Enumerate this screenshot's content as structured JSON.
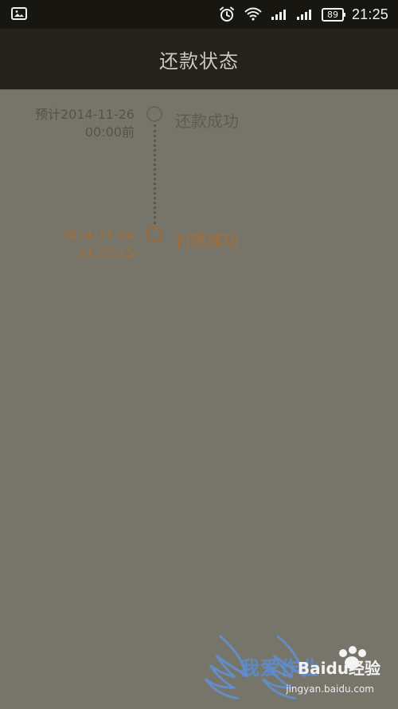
{
  "status_bar": {
    "icons": [
      "image-icon",
      "alarm-icon",
      "wifi-icon",
      "signal-icon",
      "signal-icon",
      "battery-icon"
    ],
    "battery_level": "89",
    "time": "21:25"
  },
  "header": {
    "title": "还款状态"
  },
  "timeline": {
    "steps": [
      {
        "label": "还款成功",
        "time_line1": "预计2014-11-26",
        "time_line2": "00:00前",
        "status": "pending"
      },
      {
        "label": "付款成功",
        "time_line1": "2014-11-24",
        "time_line2": "21:22:15",
        "status": "done"
      }
    ]
  },
  "watermark": {
    "brand_text": "Baidu经验",
    "brand_cn": "我爱作业",
    "url": "jingyan.baidu.com"
  },
  "colors": {
    "status_bar_bg": "#181611",
    "title_bar_bg": "#23221d",
    "body_bg": "#77756a",
    "accent": "#a66e35",
    "pending_text": "#5d5b53"
  }
}
